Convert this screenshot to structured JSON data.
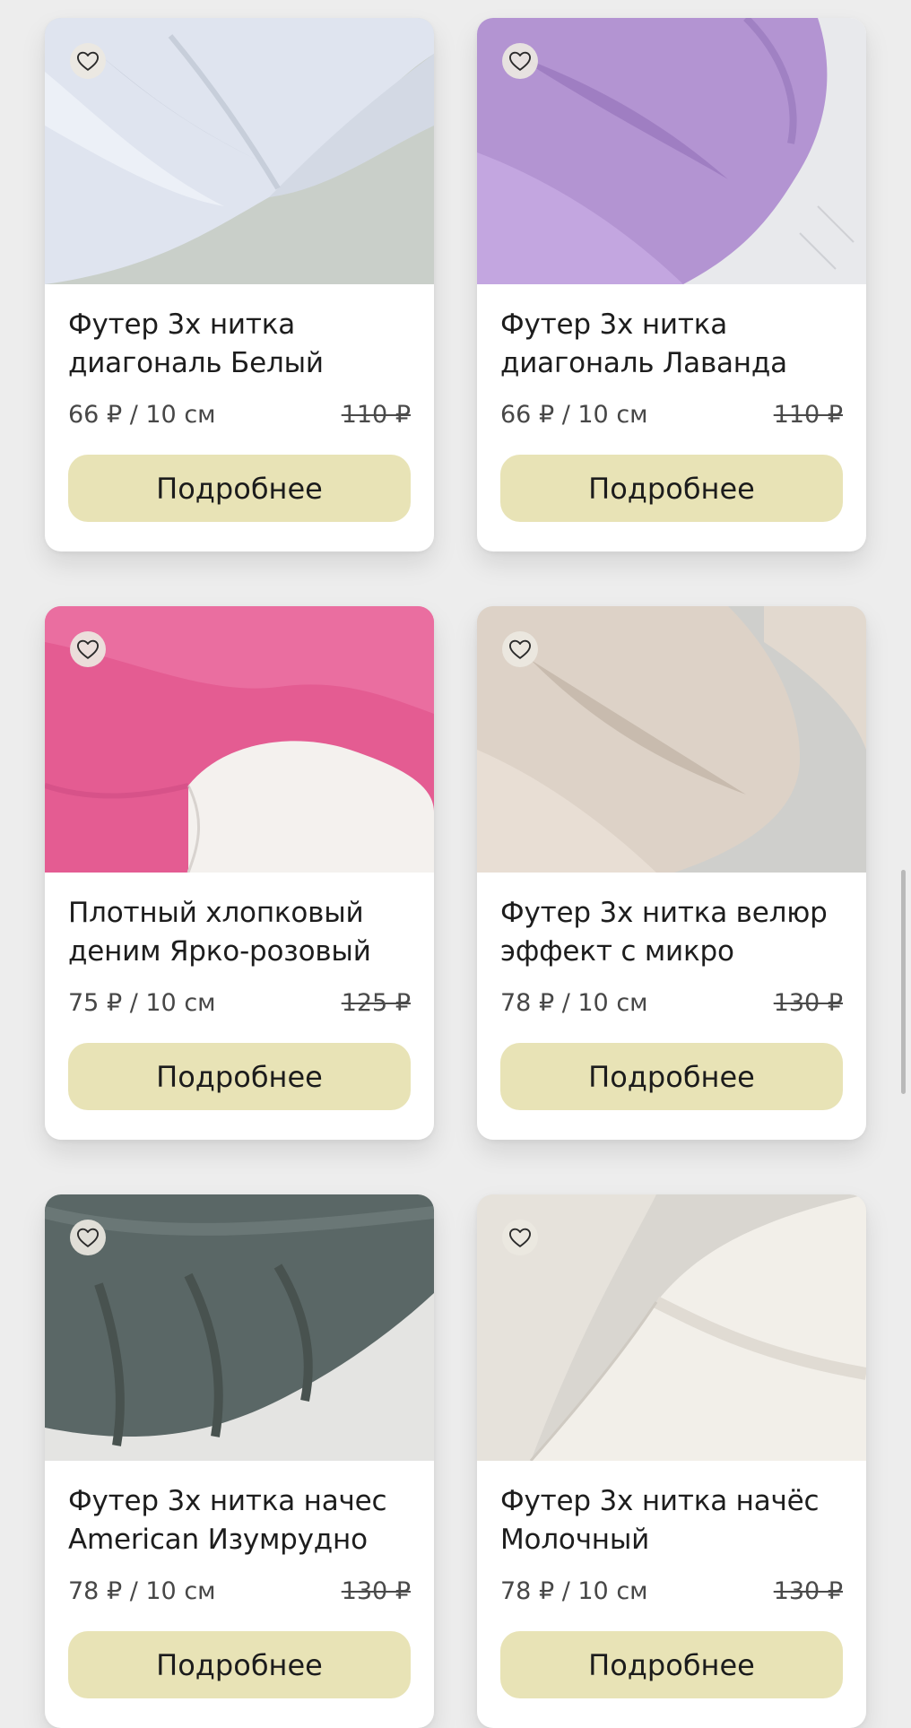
{
  "products": [
    {
      "title": "Футер 3х нитка диагональ Белый",
      "price": "66 ₽ / 10 см",
      "old_price": "110 ₽",
      "button": "Подробнее",
      "photo_color": "#dfe4ef"
    },
    {
      "title": "Футер 3х нитка диагональ Лаванда",
      "price": "66 ₽ / 10 см",
      "old_price": "110 ₽",
      "button": "Подробнее",
      "photo_color": "#b394d2"
    },
    {
      "title": "Плотный хлопковый деним Ярко-розовый",
      "price": "75 ₽ / 10 см",
      "old_price": "125 ₽",
      "button": "Подробнее",
      "photo_color": "#e45c92"
    },
    {
      "title": "Футер 3х нитка велюр эффект с микро",
      "price": "78 ₽ / 10 см",
      "old_price": "130 ₽",
      "button": "Подробнее",
      "photo_color": "#ddd2c7"
    },
    {
      "title": "Футер 3х нитка начес American Изумрудно",
      "price": "78 ₽ / 10 см",
      "old_price": "130 ₽",
      "button": "Подробнее",
      "photo_color": "#5a6766"
    },
    {
      "title": "Футер 3х нитка начёс Молочный",
      "price": "78 ₽ / 10 см",
      "old_price": "130 ₽",
      "button": "Подробнее",
      "photo_color": "#f2efe9"
    }
  ],
  "icons": {
    "favorite": "heart-outline-icon"
  },
  "colors": {
    "button_bg": "#e8e3b6",
    "page_bg": "#ededed"
  }
}
